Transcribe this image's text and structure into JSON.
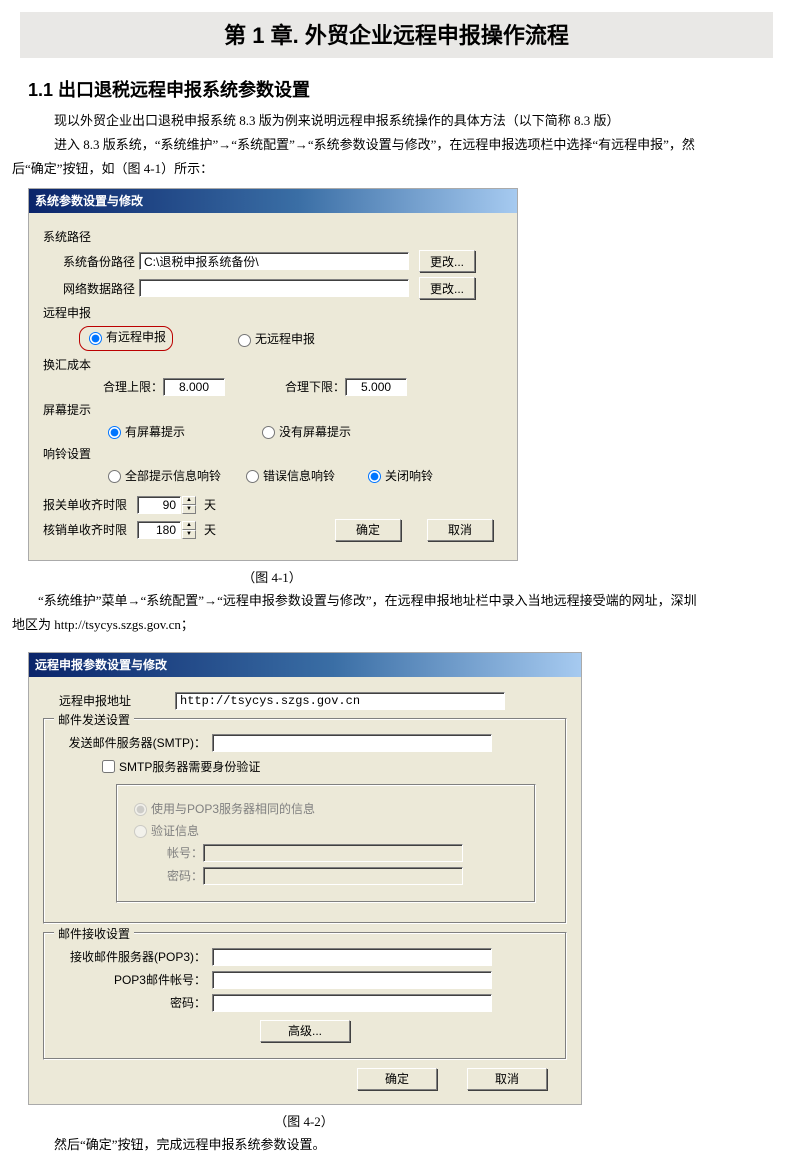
{
  "chapter_title": "第 1 章. 外贸企业远程申报操作流程",
  "section_title": "1.1 出口退税远程申报系统参数设置",
  "para1": "现以外贸企业出口退税申报系统 8.3 版为例来说明远程申报系统操作的具体方法（以下简称 8.3 版）",
  "para2_a": "进入 8.3 版系统，",
  "para2_b": "“系统维护”→“系统配置”→“系统参数设置与修改”，在远程申报选项栏中选择“有远程申报”，然",
  "para2_c": "后",
  "para2_d": "“确定”按钮，如（图 4-1）所示：",
  "fig41": "（图 4-1）",
  "para3_a": "“系统维护”菜单→“系统配置”→“远程申报参数设置与修改”，在远程申报地址栏中录入当地远程接受端的网址，深圳",
  "para3_b": "地区为 http://tsycys.szgs.gov.cn；",
  "fig42": "（图 4-2）",
  "para4_a": "然后",
  "para4_b": "“确定”按钮，完成远程申报系统参数设置。",
  "dlg1": {
    "title": "系统参数设置与修改",
    "sys_path_label": "系统路径",
    "backup_label": "系统备份路径",
    "backup_value": "C:\\退税申报系统备份\\",
    "netdata_label": "网络数据路径",
    "netdata_value": "",
    "change_btn": "更改...",
    "remote_label": "远程申报",
    "remote_yes": "有远程申报",
    "remote_no": "无远程申报",
    "huanhui_label": "换汇成本",
    "upper_label": "合理上限：",
    "upper_value": "8.000",
    "lower_label": "合理下限：",
    "lower_value": "5.000",
    "screen_label": "屏幕提示",
    "screen_yes": "有屏幕提示",
    "screen_no": "没有屏幕提示",
    "ring_label": "响铃设置",
    "ring_all": "全部提示信息响铃",
    "ring_err": "错误信息响铃",
    "ring_off": "关闭响铃",
    "baoguan_label": "报关单收齐时限",
    "baoguan_value": "90",
    "hexiao_label": "核销单收齐时限",
    "hexiao_value": "180",
    "days": "天",
    "ok": "确定",
    "cancel": "取消"
  },
  "dlg2": {
    "title": "远程申报参数设置与修改",
    "addr_label": "远程申报地址",
    "addr_value": "http://tsycys.szgs.gov.cn",
    "send_legend": "邮件发送设置",
    "smtp_label": "发送邮件服务器(SMTP)：",
    "smtp_value": "",
    "smtp_auth": "SMTP服务器需要身份验证",
    "same_pop3": "使用与POP3服务器相同的信息",
    "verify_info": "验证信息",
    "acct_label": "帐号：",
    "pwd_label": "密码：",
    "recv_legend": "邮件接收设置",
    "pop3_label": "接收邮件服务器(POP3)：",
    "pop3_value": "",
    "pop3_acct_label": "POP3邮件帐号：",
    "adv": "高级...",
    "ok": "确定",
    "cancel": "取消"
  }
}
